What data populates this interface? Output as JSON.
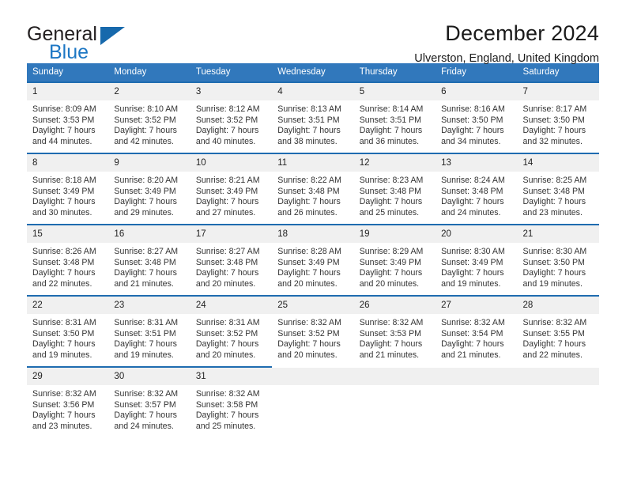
{
  "brand": {
    "name_top": "General",
    "name_bottom": "Blue",
    "triangle_icon": "triangle-icon",
    "colors": {
      "dark": "#231f20",
      "blue": "#1d77c4",
      "triangle": "#1769ac"
    }
  },
  "header": {
    "title": "December 2024",
    "subtitle": "Ulverston, England, United Kingdom"
  },
  "calendar": {
    "accent_color": "#3178bc",
    "row_rule_color": "#1f6cb0",
    "daynum_background": "#f0f0f0",
    "weekday_headers": [
      "Sunday",
      "Monday",
      "Tuesday",
      "Wednesday",
      "Thursday",
      "Friday",
      "Saturday"
    ],
    "weeks": [
      [
        {
          "day": "1",
          "sunrise": "Sunrise: 8:09 AM",
          "sunset": "Sunset: 3:53 PM",
          "daylight_line1": "Daylight: 7 hours",
          "daylight_line2": "and 44 minutes."
        },
        {
          "day": "2",
          "sunrise": "Sunrise: 8:10 AM",
          "sunset": "Sunset: 3:52 PM",
          "daylight_line1": "Daylight: 7 hours",
          "daylight_line2": "and 42 minutes."
        },
        {
          "day": "3",
          "sunrise": "Sunrise: 8:12 AM",
          "sunset": "Sunset: 3:52 PM",
          "daylight_line1": "Daylight: 7 hours",
          "daylight_line2": "and 40 minutes."
        },
        {
          "day": "4",
          "sunrise": "Sunrise: 8:13 AM",
          "sunset": "Sunset: 3:51 PM",
          "daylight_line1": "Daylight: 7 hours",
          "daylight_line2": "and 38 minutes."
        },
        {
          "day": "5",
          "sunrise": "Sunrise: 8:14 AM",
          "sunset": "Sunset: 3:51 PM",
          "daylight_line1": "Daylight: 7 hours",
          "daylight_line2": "and 36 minutes."
        },
        {
          "day": "6",
          "sunrise": "Sunrise: 8:16 AM",
          "sunset": "Sunset: 3:50 PM",
          "daylight_line1": "Daylight: 7 hours",
          "daylight_line2": "and 34 minutes."
        },
        {
          "day": "7",
          "sunrise": "Sunrise: 8:17 AM",
          "sunset": "Sunset: 3:50 PM",
          "daylight_line1": "Daylight: 7 hours",
          "daylight_line2": "and 32 minutes."
        }
      ],
      [
        {
          "day": "8",
          "sunrise": "Sunrise: 8:18 AM",
          "sunset": "Sunset: 3:49 PM",
          "daylight_line1": "Daylight: 7 hours",
          "daylight_line2": "and 30 minutes."
        },
        {
          "day": "9",
          "sunrise": "Sunrise: 8:20 AM",
          "sunset": "Sunset: 3:49 PM",
          "daylight_line1": "Daylight: 7 hours",
          "daylight_line2": "and 29 minutes."
        },
        {
          "day": "10",
          "sunrise": "Sunrise: 8:21 AM",
          "sunset": "Sunset: 3:49 PM",
          "daylight_line1": "Daylight: 7 hours",
          "daylight_line2": "and 27 minutes."
        },
        {
          "day": "11",
          "sunrise": "Sunrise: 8:22 AM",
          "sunset": "Sunset: 3:48 PM",
          "daylight_line1": "Daylight: 7 hours",
          "daylight_line2": "and 26 minutes."
        },
        {
          "day": "12",
          "sunrise": "Sunrise: 8:23 AM",
          "sunset": "Sunset: 3:48 PM",
          "daylight_line1": "Daylight: 7 hours",
          "daylight_line2": "and 25 minutes."
        },
        {
          "day": "13",
          "sunrise": "Sunrise: 8:24 AM",
          "sunset": "Sunset: 3:48 PM",
          "daylight_line1": "Daylight: 7 hours",
          "daylight_line2": "and 24 minutes."
        },
        {
          "day": "14",
          "sunrise": "Sunrise: 8:25 AM",
          "sunset": "Sunset: 3:48 PM",
          "daylight_line1": "Daylight: 7 hours",
          "daylight_line2": "and 23 minutes."
        }
      ],
      [
        {
          "day": "15",
          "sunrise": "Sunrise: 8:26 AM",
          "sunset": "Sunset: 3:48 PM",
          "daylight_line1": "Daylight: 7 hours",
          "daylight_line2": "and 22 minutes."
        },
        {
          "day": "16",
          "sunrise": "Sunrise: 8:27 AM",
          "sunset": "Sunset: 3:48 PM",
          "daylight_line1": "Daylight: 7 hours",
          "daylight_line2": "and 21 minutes."
        },
        {
          "day": "17",
          "sunrise": "Sunrise: 8:27 AM",
          "sunset": "Sunset: 3:48 PM",
          "daylight_line1": "Daylight: 7 hours",
          "daylight_line2": "and 20 minutes."
        },
        {
          "day": "18",
          "sunrise": "Sunrise: 8:28 AM",
          "sunset": "Sunset: 3:49 PM",
          "daylight_line1": "Daylight: 7 hours",
          "daylight_line2": "and 20 minutes."
        },
        {
          "day": "19",
          "sunrise": "Sunrise: 8:29 AM",
          "sunset": "Sunset: 3:49 PM",
          "daylight_line1": "Daylight: 7 hours",
          "daylight_line2": "and 20 minutes."
        },
        {
          "day": "20",
          "sunrise": "Sunrise: 8:30 AM",
          "sunset": "Sunset: 3:49 PM",
          "daylight_line1": "Daylight: 7 hours",
          "daylight_line2": "and 19 minutes."
        },
        {
          "day": "21",
          "sunrise": "Sunrise: 8:30 AM",
          "sunset": "Sunset: 3:50 PM",
          "daylight_line1": "Daylight: 7 hours",
          "daylight_line2": "and 19 minutes."
        }
      ],
      [
        {
          "day": "22",
          "sunrise": "Sunrise: 8:31 AM",
          "sunset": "Sunset: 3:50 PM",
          "daylight_line1": "Daylight: 7 hours",
          "daylight_line2": "and 19 minutes."
        },
        {
          "day": "23",
          "sunrise": "Sunrise: 8:31 AM",
          "sunset": "Sunset: 3:51 PM",
          "daylight_line1": "Daylight: 7 hours",
          "daylight_line2": "and 19 minutes."
        },
        {
          "day": "24",
          "sunrise": "Sunrise: 8:31 AM",
          "sunset": "Sunset: 3:52 PM",
          "daylight_line1": "Daylight: 7 hours",
          "daylight_line2": "and 20 minutes."
        },
        {
          "day": "25",
          "sunrise": "Sunrise: 8:32 AM",
          "sunset": "Sunset: 3:52 PM",
          "daylight_line1": "Daylight: 7 hours",
          "daylight_line2": "and 20 minutes."
        },
        {
          "day": "26",
          "sunrise": "Sunrise: 8:32 AM",
          "sunset": "Sunset: 3:53 PM",
          "daylight_line1": "Daylight: 7 hours",
          "daylight_line2": "and 21 minutes."
        },
        {
          "day": "27",
          "sunrise": "Sunrise: 8:32 AM",
          "sunset": "Sunset: 3:54 PM",
          "daylight_line1": "Daylight: 7 hours",
          "daylight_line2": "and 21 minutes."
        },
        {
          "day": "28",
          "sunrise": "Sunrise: 8:32 AM",
          "sunset": "Sunset: 3:55 PM",
          "daylight_line1": "Daylight: 7 hours",
          "daylight_line2": "and 22 minutes."
        }
      ],
      [
        {
          "day": "29",
          "sunrise": "Sunrise: 8:32 AM",
          "sunset": "Sunset: 3:56 PM",
          "daylight_line1": "Daylight: 7 hours",
          "daylight_line2": "and 23 minutes."
        },
        {
          "day": "30",
          "sunrise": "Sunrise: 8:32 AM",
          "sunset": "Sunset: 3:57 PM",
          "daylight_line1": "Daylight: 7 hours",
          "daylight_line2": "and 24 minutes."
        },
        {
          "day": "31",
          "sunrise": "Sunrise: 8:32 AM",
          "sunset": "Sunset: 3:58 PM",
          "daylight_line1": "Daylight: 7 hours",
          "daylight_line2": "and 25 minutes."
        },
        {
          "day": "",
          "sunrise": "",
          "sunset": "",
          "daylight_line1": "",
          "daylight_line2": ""
        },
        {
          "day": "",
          "sunrise": "",
          "sunset": "",
          "daylight_line1": "",
          "daylight_line2": ""
        },
        {
          "day": "",
          "sunrise": "",
          "sunset": "",
          "daylight_line1": "",
          "daylight_line2": ""
        },
        {
          "day": "",
          "sunrise": "",
          "sunset": "",
          "daylight_line1": "",
          "daylight_line2": ""
        }
      ]
    ]
  }
}
